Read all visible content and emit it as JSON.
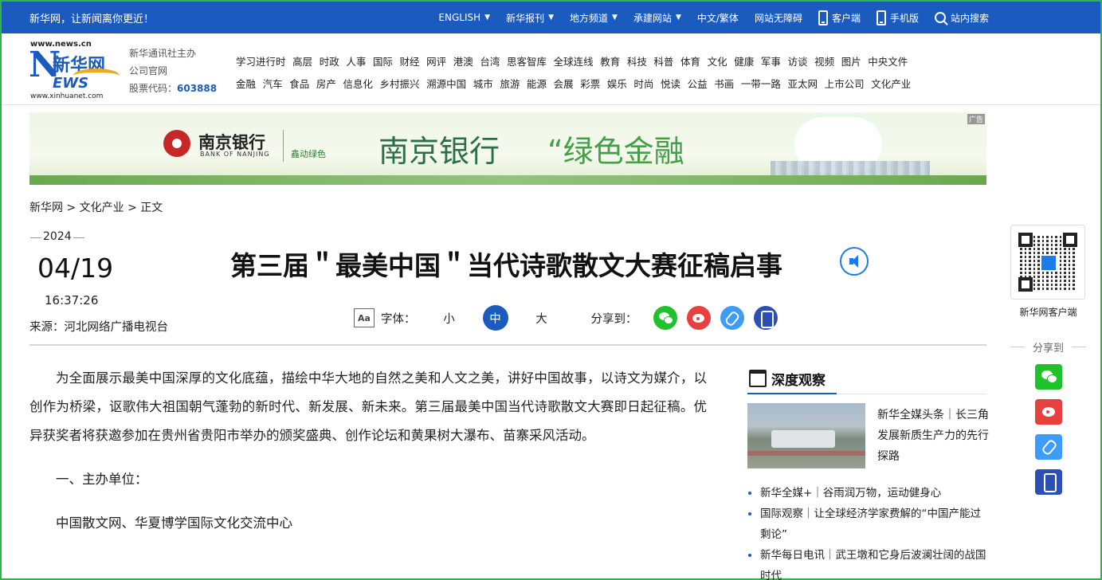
{
  "topbar": {
    "slogan": "新华网，让新闻离你更近！",
    "nav": [
      {
        "label": "ENGLISH",
        "caret": true
      },
      {
        "label": "新华报刊",
        "caret": true
      },
      {
        "label": "地方频道",
        "caret": true
      },
      {
        "label": "承建网站",
        "caret": true
      },
      {
        "label": "中文/繁体",
        "caret": false
      },
      {
        "label": "网站无障碍",
        "caret": false
      }
    ],
    "client_label": "客户端",
    "mobile_label": "手机版",
    "search_label": "站内搜索"
  },
  "logo": {
    "url_top": "www.news.cn",
    "url_bottom": "www.xinhuanet.com",
    "n": "N",
    "cn": "新华网",
    "ews": "EWS"
  },
  "corp": {
    "line1": "新华通讯社主办",
    "line2": "公司官网",
    "stock_label": "股票代码：",
    "stock_code": "603888"
  },
  "channels": {
    "row1": [
      "学习进行时",
      "高层",
      "时政",
      "人事",
      "国际",
      "财经",
      "网评",
      "港澳",
      "台湾",
      "思客智库",
      "全球连线",
      "教育",
      "科技",
      "科普",
      "体育",
      "文化",
      "健康",
      "军事",
      "访谈",
      "视频",
      "图片",
      "中央文件"
    ],
    "row2": [
      "金融",
      "汽车",
      "食品",
      "房产",
      "信息化",
      "乡村振兴",
      "溯源中国",
      "城市",
      "旅游",
      "能源",
      "会展",
      "彩票",
      "娱乐",
      "时尚",
      "悦读",
      "公益",
      "书画",
      "一带一路",
      "亚太网",
      "上市公司",
      "文化产业"
    ]
  },
  "ad": {
    "bank_name": "南京银行",
    "bank_en": "BANK OF NANJING",
    "sub": "鑫动绿色",
    "slogan1": "南京银行",
    "slogan2": "“绿色金融",
    "tag": "广告"
  },
  "breadcrumb": "新华网 > 文化产业 > 正文",
  "date": {
    "year": "2024",
    "md": "04/19",
    "time": "16:37:26"
  },
  "source": "来源：河北网络广播电视台",
  "title": "第三届＂最美中国＂当代诗歌散文大赛征稿启事",
  "tools": {
    "font_label": "字体：",
    "aa": "Aa",
    "sizes": [
      "小",
      "中",
      "大"
    ],
    "active_size": "中",
    "share_label": "分享到："
  },
  "article": {
    "paragraphs": [
      "为全面展示最美中国深厚的文化底蕴，描绘中华大地的自然之美和人文之美，讲好中国故事，以诗文为媒介，以创作为桥梁，讴歌伟大祖国朝气蓬勃的新时代、新发展、新未来。第三届最美中国当代诗歌散文大赛即日起征稿。优异获奖者将获邀参加在贵州省贵阳市举办的颁奖盛典、创作论坛和黄果树大瀑布、苗寨采风活动。",
      "一、主办单位：",
      "中国散文网、华夏博学国际文化交流中心"
    ]
  },
  "side": {
    "heading": "深度观察",
    "feature_text": "新华全媒头条｜长三角发展新质生产力的先行探路",
    "items": [
      "新华全媒+｜谷雨润万物，运动健身心",
      "国际观察｜让全球经济学家费解的“中国产能过剩论”",
      "新华每日电讯｜武王墩和它身后波澜壮阔的战国时代"
    ]
  },
  "rail": {
    "qr_caption": "新华网客户端",
    "share_heading": "分享到"
  },
  "colors": {
    "brand_blue": "#1b5bbf",
    "wechat": "#20c22c",
    "weibo": "#e6403f"
  }
}
